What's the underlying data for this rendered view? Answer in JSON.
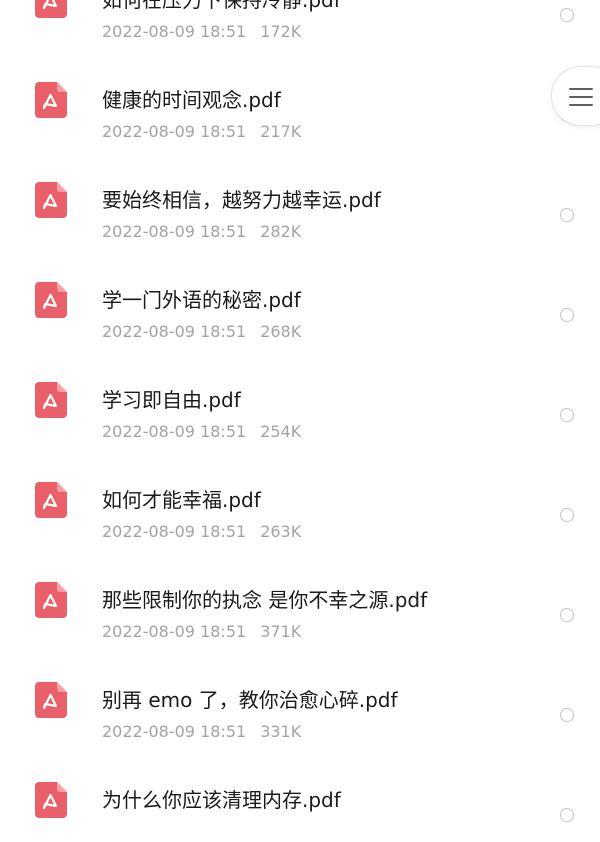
{
  "files": [
    {
      "name": "如何在压力下保持冷静.pdf",
      "date": "2022-08-09 18:51",
      "size": "172K"
    },
    {
      "name": "健康的时间观念.pdf",
      "date": "2022-08-09 18:51",
      "size": "217K"
    },
    {
      "name": "要始终相信，越努力越幸运.pdf",
      "date": "2022-08-09 18:51",
      "size": "282K"
    },
    {
      "name": "学一门外语的秘密.pdf",
      "date": "2022-08-09 18:51",
      "size": "268K"
    },
    {
      "name": "学习即自由.pdf",
      "date": "2022-08-09 18:51",
      "size": "254K"
    },
    {
      "name": "如何才能幸福.pdf",
      "date": "2022-08-09 18:51",
      "size": "263K"
    },
    {
      "name": "那些限制你的执念 是你不幸之源.pdf",
      "date": "2022-08-09 18:51",
      "size": "371K"
    },
    {
      "name": "别再 emo 了，教你治愈心碎.pdf",
      "date": "2022-08-09 18:51",
      "size": "331K"
    },
    {
      "name": "为什么你应该清理内存.pdf",
      "date": "",
      "size": ""
    }
  ],
  "icons": {
    "file_type": "pdf-icon",
    "fab": "menu-icon"
  },
  "colors": {
    "pdf_icon": "#e9606a",
    "name_text": "#1a1a1a",
    "meta_text": "#a3a3a8",
    "select_circle": "#c6c6c8"
  }
}
